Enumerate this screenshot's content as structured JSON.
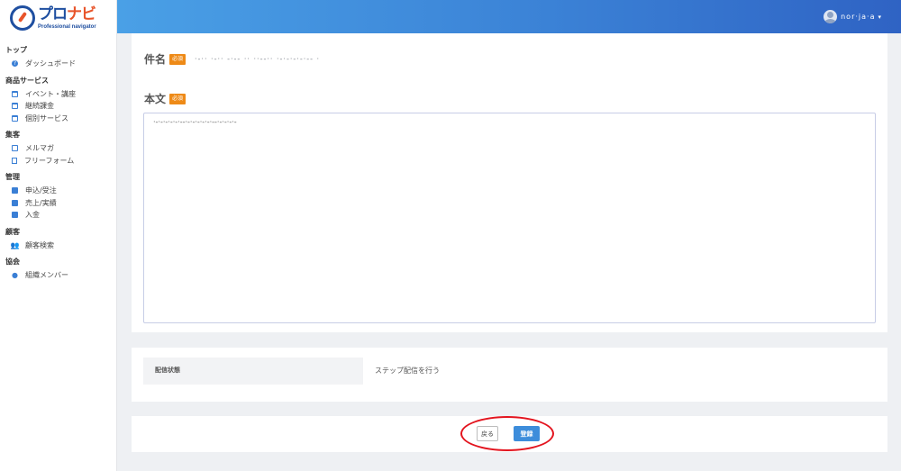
{
  "logo": {
    "title_main": "プロ",
    "title_accent": "ナビ",
    "subtitle": "Professional navigator"
  },
  "header": {
    "user_name": "nor·ja·a",
    "caret": "▾"
  },
  "sidebar": {
    "sections": [
      {
        "title": "トップ",
        "items": [
          {
            "label": "ダッシュボード",
            "icon": "question-circle-icon"
          }
        ]
      },
      {
        "title": "商品サービス",
        "items": [
          {
            "label": "イベント・講座",
            "icon": "calendar-icon"
          },
          {
            "label": "継続課金",
            "icon": "calendar-icon"
          },
          {
            "label": "個別サービス",
            "icon": "calendar-icon"
          }
        ]
      },
      {
        "title": "集客",
        "items": [
          {
            "label": "メルマガ",
            "icon": "mail-icon"
          },
          {
            "label": "フリーフォーム",
            "icon": "document-icon"
          }
        ]
      },
      {
        "title": "管理",
        "items": [
          {
            "label": "申込/受注",
            "icon": "shopping-bag-icon"
          },
          {
            "label": "売上/実績",
            "icon": "shopping-bag-icon"
          },
          {
            "label": "入金",
            "icon": "shopping-bag-icon"
          }
        ]
      },
      {
        "title": "顧客",
        "items": [
          {
            "label": "顧客検索",
            "icon": "users-icon"
          }
        ]
      },
      {
        "title": "協会",
        "items": [
          {
            "label": "組織メンバー",
            "icon": "user-icon"
          }
        ]
      }
    ]
  },
  "form": {
    "subject_label": "件名",
    "required_badge": "必須",
    "subject_value": "·-·· ·-·· -·-- ·· ··--·· ·-·-·-·-·-- ·",
    "body_label": "本文",
    "body_value": "·-·-·-·-·-·--·-·-·-·-·-·--·-·-·-·-",
    "distribution_label": "配信状態",
    "distribution_value": "ステップ配信を行う"
  },
  "actions": {
    "back_label": "戻る",
    "submit_label": "登録"
  },
  "colors": {
    "header_start": "#4aa0e6",
    "header_end": "#2f63c4",
    "required": "#ee8a17",
    "primary": "#3d8ddb",
    "highlight": "#e3141e"
  }
}
